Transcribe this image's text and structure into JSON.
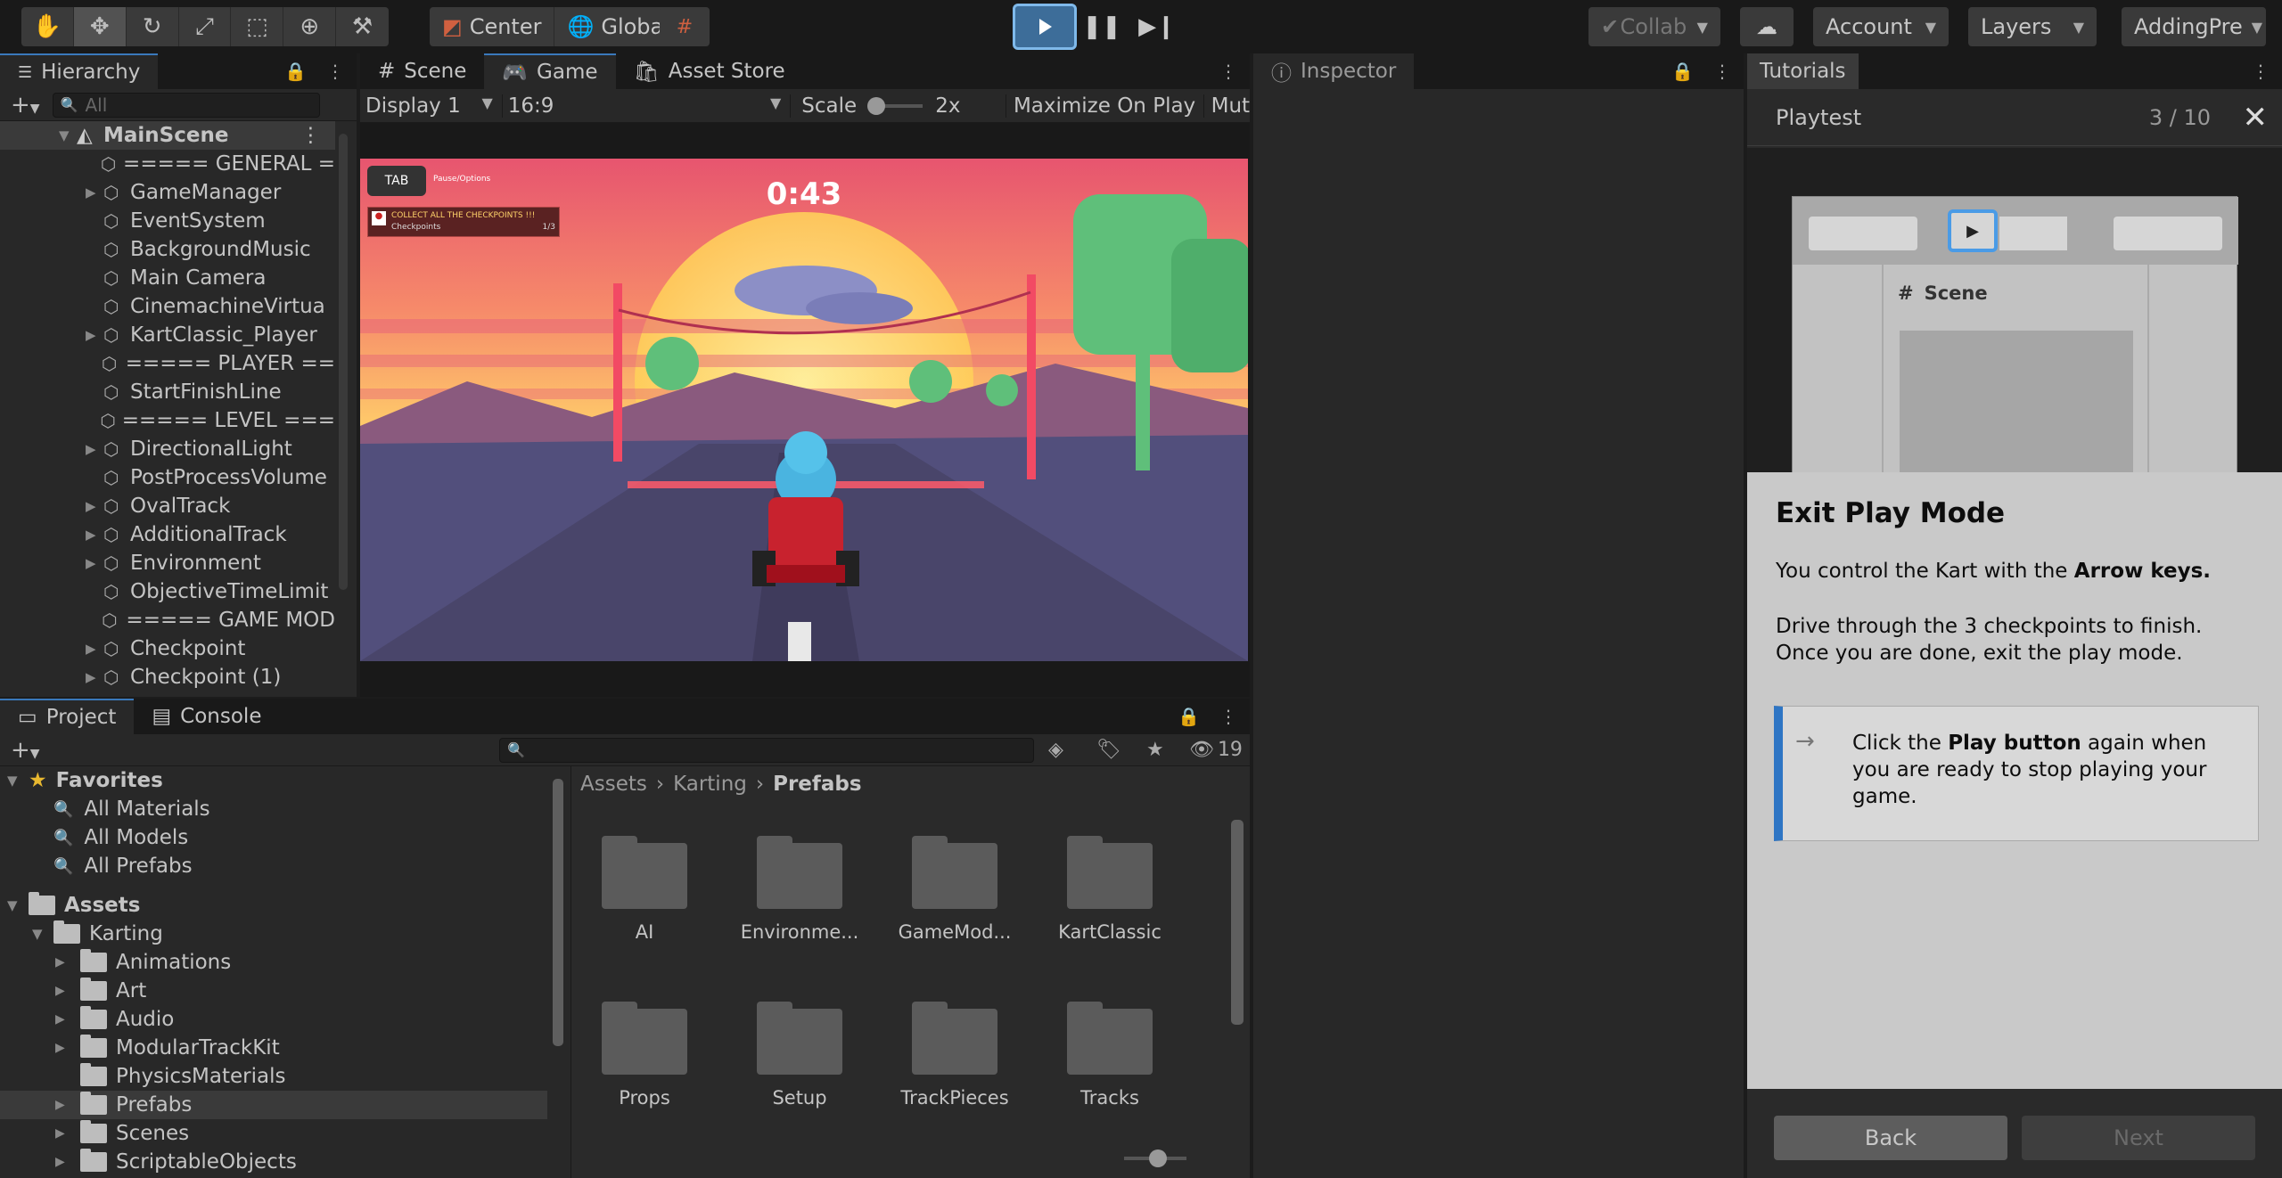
{
  "toolbar": {
    "tools": [
      "hand-tool",
      "move-tool",
      "rotate-tool",
      "scale-tool",
      "rect-tool",
      "transform-tool",
      "custom-tool"
    ],
    "pivot_label": "Center",
    "space_label": "Global",
    "collab_label": "Collab",
    "account_label": "Account",
    "layers_label": "Layers",
    "layout_label": "AddingPre"
  },
  "hierarchy": {
    "tab_label": "Hierarchy",
    "search_placeholder": "All",
    "scene_name": "MainScene",
    "items": [
      {
        "label": "===== GENERAL =",
        "expandable": false
      },
      {
        "label": "GameManager",
        "expandable": true
      },
      {
        "label": "EventSystem",
        "expandable": false
      },
      {
        "label": "BackgroundMusic",
        "expandable": false
      },
      {
        "label": "Main Camera",
        "expandable": false
      },
      {
        "label": "CinemachineVirtua",
        "expandable": false
      },
      {
        "label": "KartClassic_Player",
        "expandable": true
      },
      {
        "label": "===== PLAYER ==",
        "expandable": false
      },
      {
        "label": "StartFinishLine",
        "expandable": false
      },
      {
        "label": "===== LEVEL ===",
        "expandable": false
      },
      {
        "label": "DirectionalLight",
        "expandable": true
      },
      {
        "label": "PostProcessVolume",
        "expandable": false
      },
      {
        "label": "OvalTrack",
        "expandable": true
      },
      {
        "label": "AdditionalTrack",
        "expandable": true
      },
      {
        "label": "Environment",
        "expandable": true
      },
      {
        "label": "ObjectiveTimeLimit",
        "expandable": false
      },
      {
        "label": "===== GAME MOD",
        "expandable": false
      },
      {
        "label": "Checkpoint",
        "expandable": true
      },
      {
        "label": "Checkpoint (1)",
        "expandable": true
      }
    ]
  },
  "game_view": {
    "tabs": [
      "Scene",
      "Game",
      "Asset Store"
    ],
    "display_label": "Display 1",
    "aspect_label": "16:9",
    "scale_label": "Scale",
    "scale_value": "2x",
    "maximize_label": "Maximize On Play",
    "mute_label": "Mut",
    "hud_tab_key": "TAB",
    "hud_pause_text": "Pause/Options",
    "hud_objective": "COLLECT ALL THE CHECKPOINTS !!!",
    "hud_objective_sub": "Checkpoints",
    "hud_objective_count": "1/3",
    "timer": "0:43"
  },
  "inspector": {
    "tab_label": "Inspector"
  },
  "project": {
    "tabs": [
      "Project",
      "Console"
    ],
    "hidden_count": "19",
    "favorites_label": "Favorites",
    "favorites": [
      "All Materials",
      "All Models",
      "All Prefabs"
    ],
    "assets_label": "Assets",
    "karting_label": "Karting",
    "karting_children": [
      "Animations",
      "Art",
      "Audio",
      "ModularTrackKit",
      "PhysicsMaterials",
      "Prefabs",
      "Scenes",
      "ScriptableObjects"
    ],
    "breadcrumb": [
      "Assets",
      "Karting",
      "Prefabs"
    ],
    "folders": [
      "AI",
      "Environme...",
      "GameMod...",
      "KartClassic",
      "Props",
      "Setup",
      "TrackPieces",
      "Tracks"
    ]
  },
  "tutorials": {
    "tab_label": "Tutorials",
    "page_title": "Playtest",
    "progress": "3 / 10",
    "preview_scene_label": "Scene",
    "heading": "Exit Play Mode",
    "para1_prefix": "You control the Kart with the ",
    "para1_bold": "Arrow keys.",
    "para2": "Drive through the 3 checkpoints to finish. Once you are done, exit the play mode.",
    "instruction_prefix": "Click the ",
    "instruction_bold": "Play button",
    "instruction_suffix": " again when you are ready to stop playing your game.",
    "back_label": "Back",
    "next_label": "Next"
  }
}
